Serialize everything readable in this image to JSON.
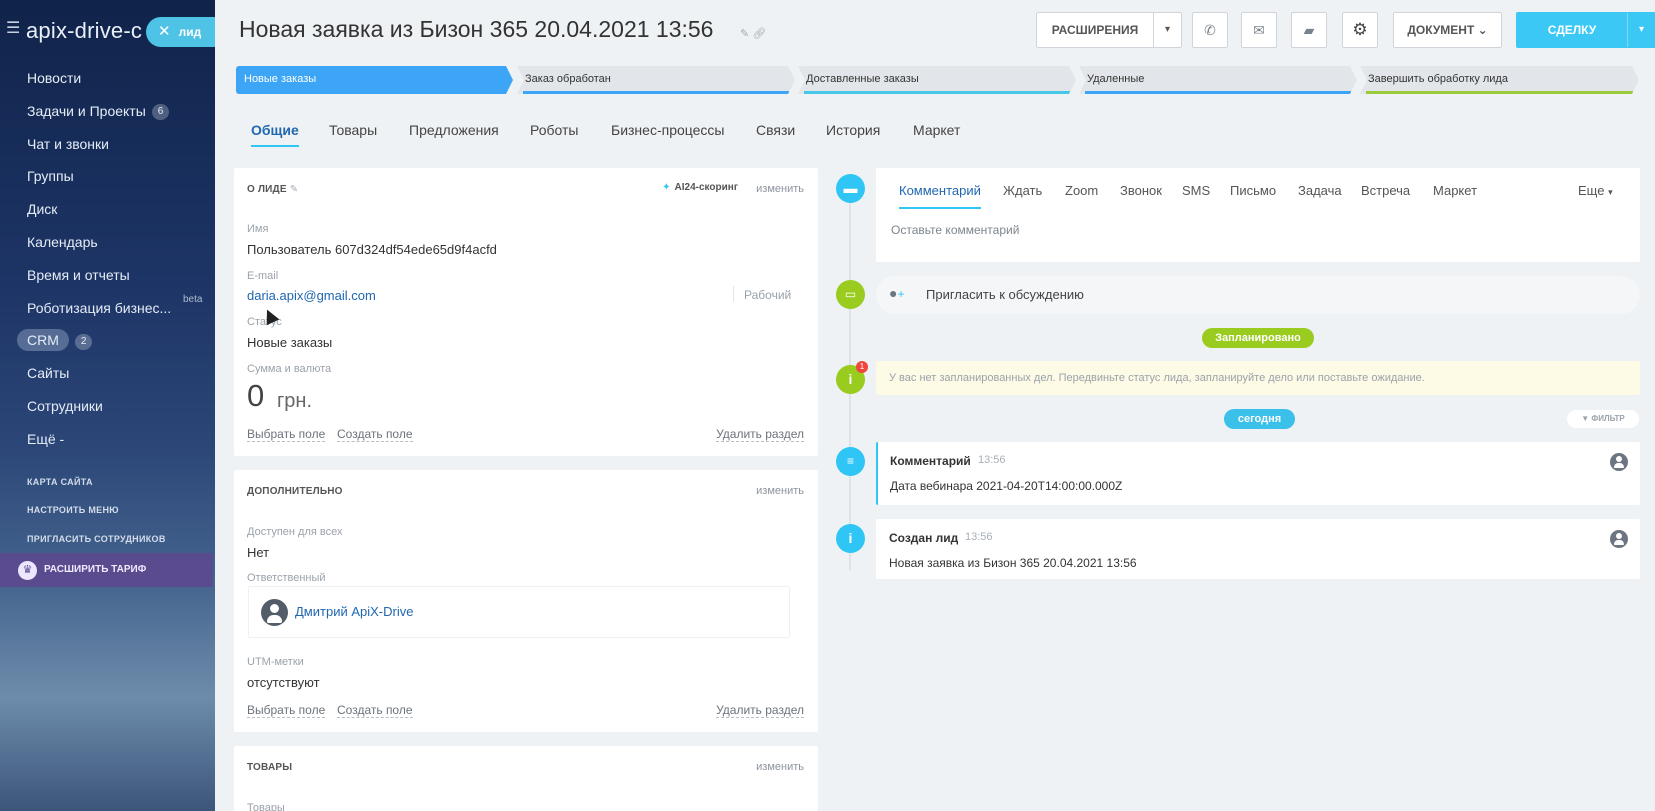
{
  "sidebar": {
    "brand": "apix-drive-c",
    "badge_label": "лид",
    "items": [
      {
        "label": "Новости"
      },
      {
        "label": "Задачи и Проекты",
        "count": "6"
      },
      {
        "label": "Чат и звонки"
      },
      {
        "label": "Группы"
      },
      {
        "label": "Диск"
      },
      {
        "label": "Календарь"
      },
      {
        "label": "Время и отчеты"
      },
      {
        "label": "Роботизация бизнес...",
        "tag": "beta"
      },
      {
        "label": "CRM",
        "count": "2"
      },
      {
        "label": "Сайты"
      },
      {
        "label": "Сотрудники"
      },
      {
        "label": "Ещё -"
      }
    ],
    "links": [
      "КАРТА САЙТА",
      "НАСТРОИТЬ МЕНЮ",
      "ПРИГЛАСИТЬ СОТРУДНИКОВ"
    ],
    "upgrade_label": "РАСШИРИТЬ ТАРИФ"
  },
  "header": {
    "title": "Новая заявка из Бизон 365 20.04.2021  13:56",
    "extensions_label": "РАСШИРЕНИЯ",
    "document_label": "ДОКУМЕНТ",
    "deal_label": "СДЕЛКУ"
  },
  "stages": [
    {
      "label": "Новые заказы",
      "color": "#3da5f5"
    },
    {
      "label": "Заказ обработан",
      "color": "#3da5f5"
    },
    {
      "label": "Доставленные заказы",
      "color": "#47c7e8"
    },
    {
      "label": "Удаленные",
      "color": "#3da5f5"
    },
    {
      "label": "Завершить обработку лида",
      "color": "#9acb3a"
    }
  ],
  "tabs": [
    "Общие",
    "Товары",
    "Предложения",
    "Роботы",
    "Бизнес-процессы",
    "Связи",
    "История",
    "Маркет"
  ],
  "about": {
    "title": "О ЛИДЕ",
    "scoring": "AI24-скоринг",
    "edit": "изменить",
    "name_label": "Имя",
    "name_value": "Пользователь 607d324df54ede65d9f4acfd",
    "email_label": "E-mail",
    "email_value": "daria.apix@gmail.com",
    "email_type": "Рабочий",
    "status_label": "Статус",
    "status_value": "Новые заказы",
    "sum_label": "Сумма и валюта",
    "sum_value": "0",
    "currency": "грн.",
    "select_field": "Выбрать поле",
    "create_field": "Создать поле",
    "delete_section": "Удалить раздел"
  },
  "extra": {
    "title": "ДОПОЛНИТЕЛЬНО",
    "edit": "изменить",
    "access_label": "Доступен для всех",
    "access_value": "Нет",
    "responsible_label": "Ответственный",
    "responsible_value": "Дмитрий ApiX-Drive",
    "utm_label": "UTM-метки",
    "utm_value": "отсутствуют",
    "select_field": "Выбрать поле",
    "create_field": "Создать поле",
    "delete_section": "Удалить раздел"
  },
  "goods": {
    "title": "ТОВАРЫ",
    "edit": "изменить",
    "label": "Товары"
  },
  "timeline": {
    "tabs": [
      "Комментарий",
      "Ждать",
      "Zoom",
      "Звонок",
      "SMS",
      "Письмо",
      "Задача",
      "Встреча",
      "Маркет"
    ],
    "more": "Еще",
    "comment_placeholder": "Оставьте комментарий",
    "invite": "Пригласить к обсуждению",
    "planned_pill": "Запланировано",
    "planned_badge": "1",
    "planned_text": "У вас нет запланированных дел. Передвиньте статус лида, запланируйте дело или поставьте ожидание.",
    "today_pill": "сегодня",
    "filter": "ФИЛЬТР",
    "entries": [
      {
        "title": "Комментарий",
        "time": "13:56",
        "text": "Дата вебинара 2021-04-20T14:00:00.000Z"
      },
      {
        "title": "Создан лид",
        "time": "13:56",
        "text": "Новая заявка из Бизон 365 20.04.2021 13:56"
      }
    ]
  },
  "colors": {
    "accent": "#2fc6f6",
    "link": "#2067b0",
    "stage_active": "#3da5f5",
    "planned": "#9acb1f",
    "today": "#3bc0ea"
  }
}
